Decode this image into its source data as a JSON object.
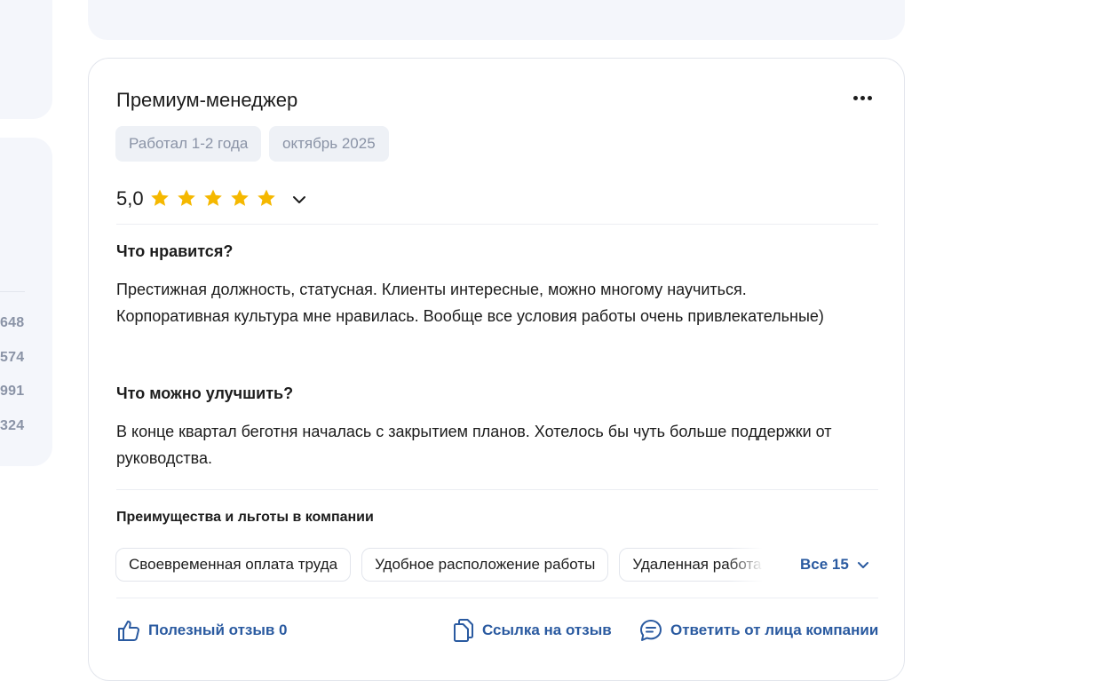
{
  "left_panel": {
    "numbers": [
      "648",
      "574",
      "991",
      "324"
    ]
  },
  "review": {
    "title": "Премиум-менеджер",
    "tags": [
      "Работал 1-2 года",
      "октябрь 2025"
    ],
    "rating": "5,0",
    "stars": 5,
    "likes_title": "Что нравится?",
    "likes_text": "Престижная должность, статусная. Клиенты интересные, можно многому научиться. Корпоративная культура мне нравилась. Вообще все условия работы очень привлекательные)",
    "improve_title": "Что можно улучшить?",
    "improve_text": "В конце квартал беготня началась с закрытием планов. Хотелось бы чуть больше поддержки от руководства.",
    "benefits_title": "Преимущества и льготы в компании",
    "benefits": [
      "Своевременная оплата труда",
      "Удобное расположение работы",
      "Удаленная работа"
    ],
    "benefits_all": "Все 15",
    "actions": {
      "helpful": "Полезный отзыв 0",
      "link": "Ссылка на отзыв",
      "reply": "Ответить от лица компании"
    }
  },
  "colors": {
    "accent": "#2a5aa0",
    "star": "#f5b800",
    "muted": "#8a93a6",
    "panel": "#f4f6fb"
  },
  "icons": [
    "more-icon",
    "star-icon",
    "chevron-down-icon",
    "thumbs-up-icon",
    "copy-link-icon",
    "chat-icon"
  ]
}
